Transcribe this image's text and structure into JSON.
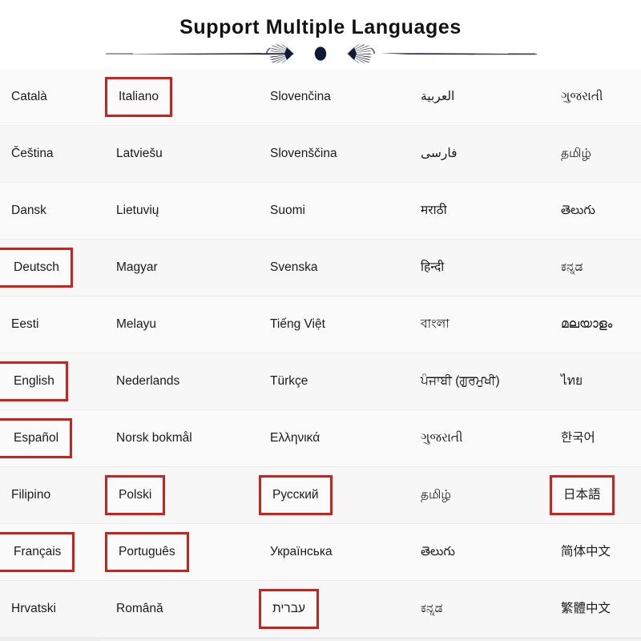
{
  "header": {
    "title": "Support Multiple Languages",
    "divider_icon": "ornamental-fan-divider",
    "title_color": "#121212",
    "divider_color": "#101a35"
  },
  "theme": {
    "background": "#fafafa",
    "row_separator": "#eeeeee",
    "text_color": "#1b1b1b",
    "highlight_color": "#d0201a"
  },
  "language_table": {
    "columns": 5,
    "rows": 10,
    "cells": [
      [
        {
          "label": "Català",
          "highlighted": false
        },
        {
          "label": "Italiano",
          "highlighted": true
        },
        {
          "label": "Slovenčina",
          "highlighted": false
        },
        {
          "label": "العربية",
          "highlighted": false
        },
        {
          "label": "ગુજરાતી",
          "highlighted": false
        }
      ],
      [
        {
          "label": "Čeština",
          "highlighted": false
        },
        {
          "label": "Latviešu",
          "highlighted": false
        },
        {
          "label": "Slovenščina",
          "highlighted": false
        },
        {
          "label": "فارسی",
          "highlighted": false
        },
        {
          "label": "தமிழ்",
          "highlighted": false
        }
      ],
      [
        {
          "label": "Dansk",
          "highlighted": false
        },
        {
          "label": "Lietuvių",
          "highlighted": false
        },
        {
          "label": "Suomi",
          "highlighted": false
        },
        {
          "label": "मराठी",
          "highlighted": false
        },
        {
          "label": "తెలుగు",
          "highlighted": false
        }
      ],
      [
        {
          "label": "Deutsch",
          "highlighted": true
        },
        {
          "label": "Magyar",
          "highlighted": false
        },
        {
          "label": "Svenska",
          "highlighted": false
        },
        {
          "label": "हिन्दी",
          "highlighted": false
        },
        {
          "label": "ಕನ್ನಡ",
          "highlighted": false
        }
      ],
      [
        {
          "label": "Eesti",
          "highlighted": false
        },
        {
          "label": "Melayu",
          "highlighted": false
        },
        {
          "label": "Tiếng Việt",
          "highlighted": false
        },
        {
          "label": "বাংলা",
          "highlighted": false
        },
        {
          "label": "മലയാളം",
          "highlighted": false
        }
      ],
      [
        {
          "label": "English",
          "highlighted": true
        },
        {
          "label": "Nederlands",
          "highlighted": false
        },
        {
          "label": "Türkçe",
          "highlighted": false
        },
        {
          "label": "ਪੰਜਾਬੀ (ਗੁਰਮੁਖੀ)",
          "highlighted": false
        },
        {
          "label": "ไทย",
          "highlighted": false
        }
      ],
      [
        {
          "label": "Español",
          "highlighted": true
        },
        {
          "label": "Norsk bokmål",
          "highlighted": false
        },
        {
          "label": "Ελληνικά",
          "highlighted": false
        },
        {
          "label": "ગુજરાતી",
          "highlighted": false
        },
        {
          "label": "한국어",
          "highlighted": false
        }
      ],
      [
        {
          "label": "Filipino",
          "highlighted": false
        },
        {
          "label": "Polski",
          "highlighted": true
        },
        {
          "label": "Русский",
          "highlighted": true
        },
        {
          "label": "தமிழ்",
          "highlighted": false
        },
        {
          "label": "日本語",
          "highlighted": true
        }
      ],
      [
        {
          "label": "Français",
          "highlighted": true
        },
        {
          "label": "Português",
          "highlighted": true
        },
        {
          "label": "Українська",
          "highlighted": false
        },
        {
          "label": "తెలుగు",
          "highlighted": false
        },
        {
          "label": "简体中文",
          "highlighted": false
        }
      ],
      [
        {
          "label": "Hrvatski",
          "highlighted": false
        },
        {
          "label": "Română",
          "highlighted": false
        },
        {
          "label": "עברית",
          "highlighted": true
        },
        {
          "label": "ಕನ್ನಡ",
          "highlighted": false
        },
        {
          "label": "繁體中文",
          "highlighted": false
        }
      ]
    ]
  }
}
